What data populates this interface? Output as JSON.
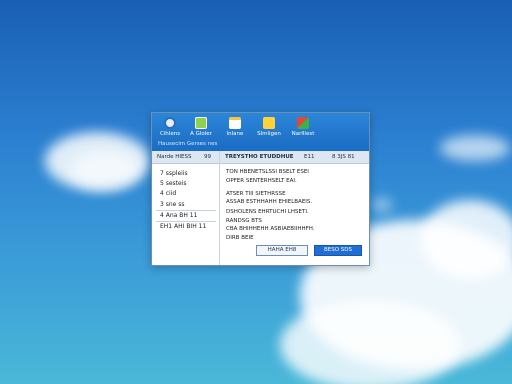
{
  "toolbar": {
    "items": [
      {
        "label": "Cihlens",
        "icon": "gear-icon",
        "color": "#e8eef6"
      },
      {
        "label": "A Gloler",
        "icon": "document-icon",
        "color": "#8fd14f"
      },
      {
        "label": "Inlane",
        "icon": "clipboard-icon",
        "color": "#f5c542"
      },
      {
        "label": "Slmligen",
        "icon": "folder-icon",
        "color": "#ffd23a"
      },
      {
        "label": "Narlllest",
        "icon": "palette-icon",
        "color": "#e0483a"
      }
    ],
    "subtitle": "Hausecim Gerses nes"
  },
  "left_pane": {
    "header": "Narde HIESS",
    "header_badge": "99",
    "items": [
      "7 sspleiis",
      "5 sesteis",
      "4 ciid",
      "3 sne ss",
      "4 Ana BH 11",
      "EH1 AHI BIH 11"
    ]
  },
  "right_pane": {
    "header_title": "TREYSTHO ETUDDHUE",
    "header_col_1": "E11",
    "header_col_2": "8 3JS 81",
    "lines": [
      "TON HBENETSLSSI BSELT ESEI",
      "OPFER SENTERHSELT EAI.",
      "ATSER TIII SIETHRSSE",
      "ASSAB ESTHHAHH EHIELBAEIS.",
      "DSHOLENS EHRTUCHI LHSETI.",
      "RANDSG BTS",
      "CBA BHIHHEHH ASBIAEBIIHHFH.",
      "DIRB BEIE"
    ]
  },
  "buttons": {
    "secondary": "HAHA EH8",
    "primary": "BESO SDS"
  }
}
